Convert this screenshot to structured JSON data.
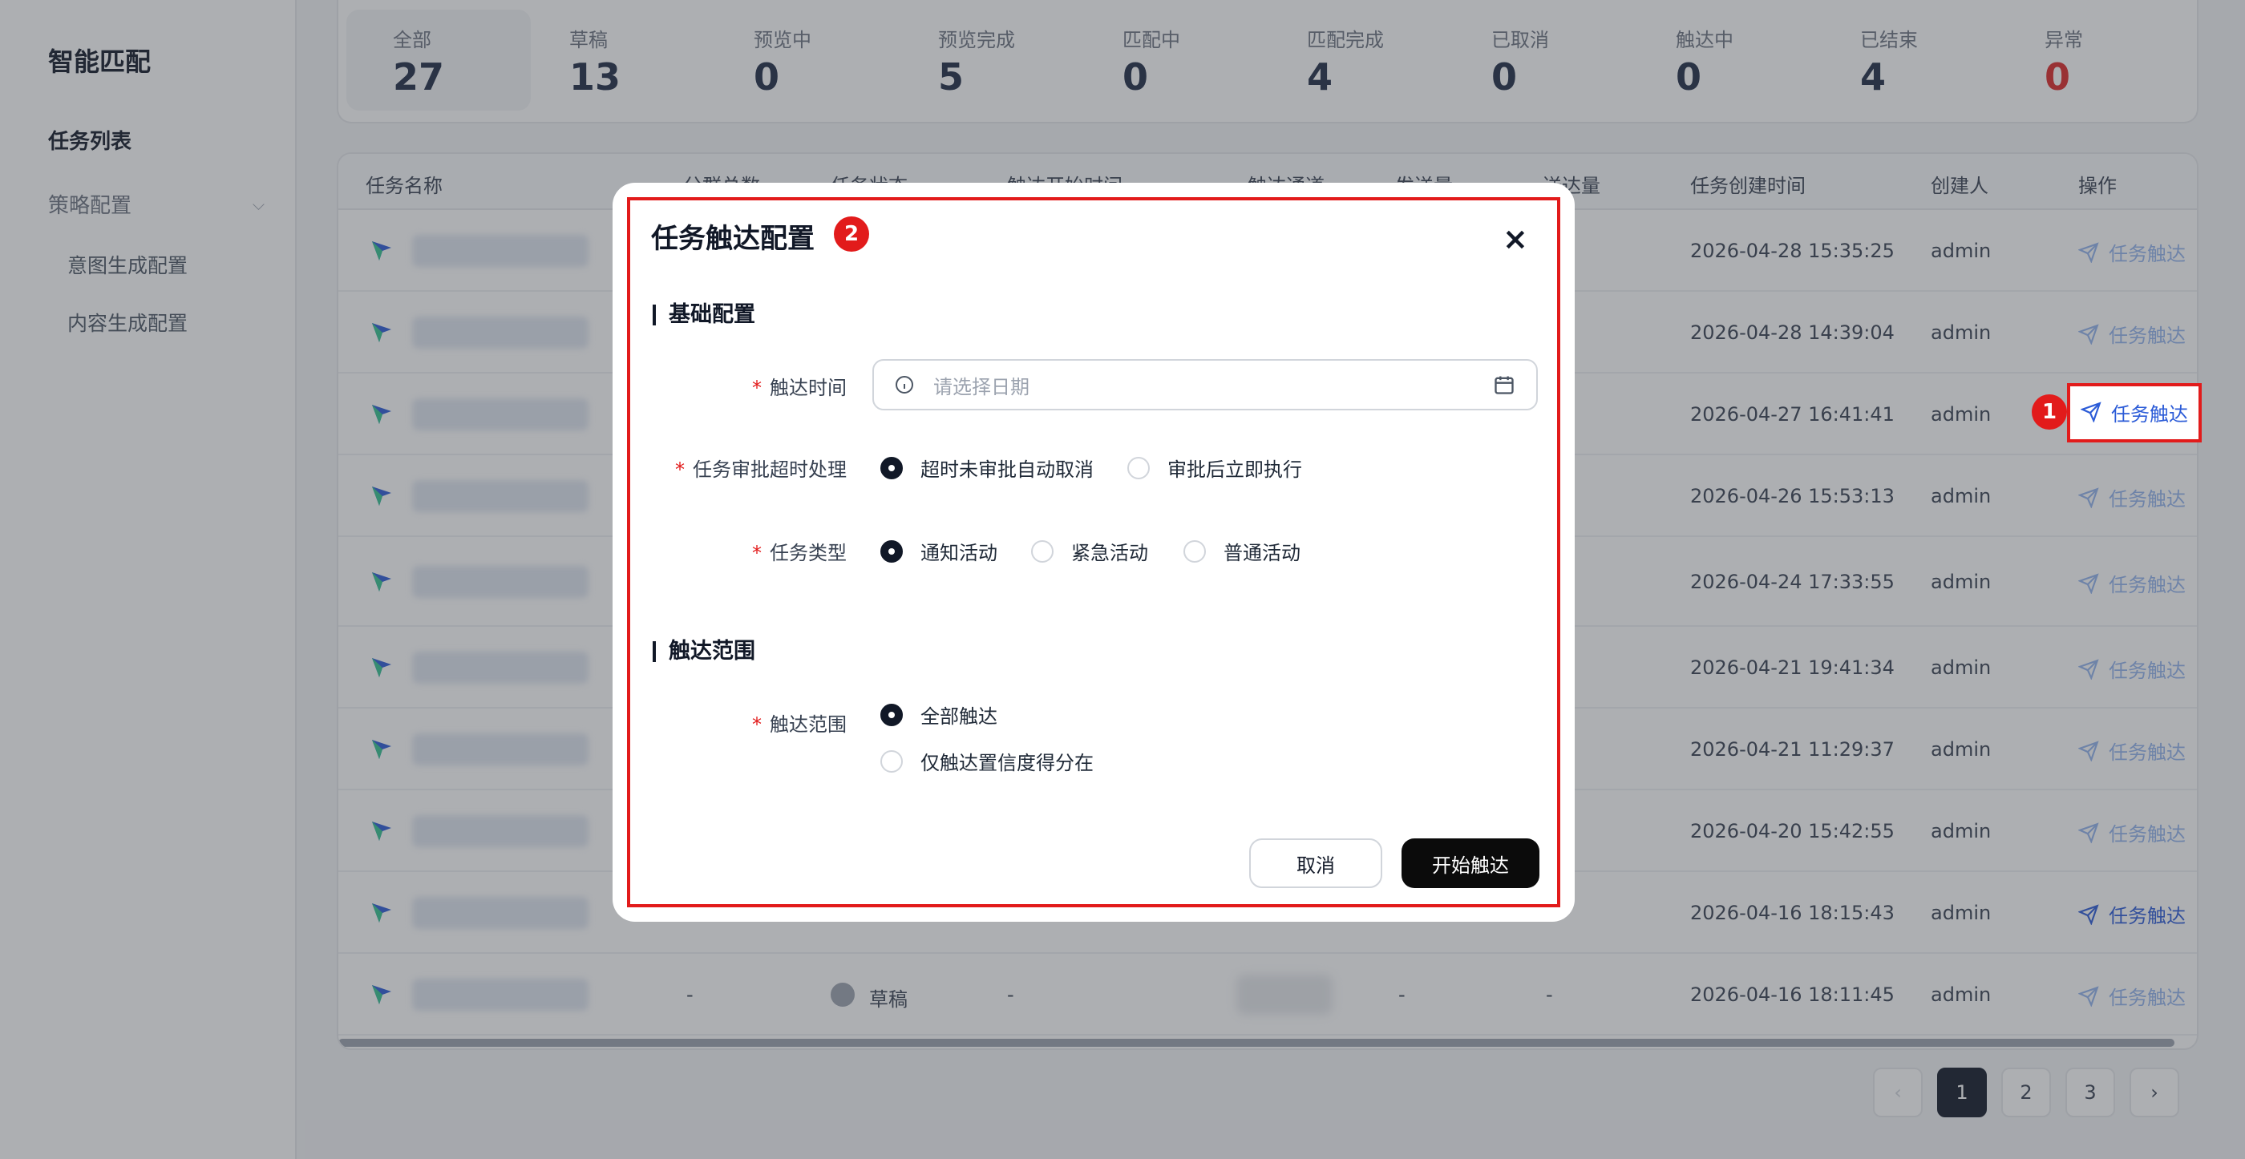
{
  "sidebar": {
    "brand": "智能匹配",
    "items": [
      {
        "label": "任务列表",
        "active": true
      },
      {
        "label": "策略配置",
        "expanded": true,
        "children": [
          {
            "label": "意图生成配置"
          },
          {
            "label": "内容生成配置"
          }
        ]
      }
    ]
  },
  "stats": [
    {
      "label": "全部",
      "value": "27",
      "selected": true
    },
    {
      "label": "草稿",
      "value": "13"
    },
    {
      "label": "预览中",
      "value": "0"
    },
    {
      "label": "预览完成",
      "value": "5"
    },
    {
      "label": "匹配中",
      "value": "0"
    },
    {
      "label": "匹配完成",
      "value": "4"
    },
    {
      "label": "已取消",
      "value": "0"
    },
    {
      "label": "触达中",
      "value": "0"
    },
    {
      "label": "已结束",
      "value": "4"
    },
    {
      "label": "异常",
      "value": "0",
      "error_color": "#dc2626"
    }
  ],
  "table": {
    "columns": [
      "任务名称",
      "分群总数",
      "任务状态",
      "触达开始时间",
      "触达通道",
      "发送量",
      "送达量",
      "任务创建时间",
      "创建人",
      "操作"
    ],
    "rows": [
      {
        "created": "2026-04-28 15:35:25",
        "creator": "admin",
        "action": "任务触达"
      },
      {
        "created": "2026-04-28 14:39:04",
        "creator": "admin",
        "action": "任务触达"
      },
      {
        "created": "2026-04-27 16:41:41",
        "creator": "admin",
        "action": "任务触达"
      },
      {
        "created": "2026-04-26 15:53:13",
        "creator": "admin",
        "action": "任务触达"
      },
      {
        "created": "2026-04-24 17:33:55",
        "creator": "admin",
        "action": "任务触达"
      },
      {
        "created": "2026-04-21 19:41:34",
        "creator": "admin",
        "action": "任务触达"
      },
      {
        "created": "2026-04-21 11:29:37",
        "creator": "admin",
        "action": "任务触达"
      },
      {
        "created": "2026-04-20 15:42:55",
        "creator": "admin",
        "action": "任务触达"
      },
      {
        "created": "2026-04-16 18:15:43",
        "creator": "admin",
        "action": "任务触达"
      },
      {
        "created": "2026-04-16 18:11:45",
        "creator": "admin",
        "action": "任务触达",
        "segments": "-",
        "status": "草稿",
        "start_time": "-",
        "sent": "-",
        "delivered": "-"
      }
    ]
  },
  "pagination": {
    "pages": [
      "1",
      "2",
      "3"
    ],
    "current": "1",
    "prev": "‹",
    "next": "›"
  },
  "annotations": {
    "marker_1": "1",
    "marker_2": "2",
    "color": "#e21b1b"
  },
  "modal": {
    "title": "任务触达配置",
    "close": "×",
    "section_basic": "基础配置",
    "section_scope": "触达范围",
    "required_mark": "*",
    "fields": {
      "reach_time": {
        "label": "触达时间",
        "placeholder": "请选择日期"
      },
      "approval_timeout": {
        "label": "任务审批超时处理",
        "options": [
          "超时未审批自动取消",
          "审批后立即执行"
        ],
        "selected": "超时未审批自动取消"
      },
      "task_type": {
        "label": "任务类型",
        "options": [
          "通知活动",
          "紧急活动",
          "普通活动"
        ],
        "selected": "通知活动"
      },
      "reach_scope": {
        "label": "触达范围",
        "options": [
          "全部触达",
          "仅触达置信度得分在"
        ],
        "selected": "全部触达"
      }
    },
    "cancel_label": "取消",
    "submit_label": "开始触达"
  }
}
